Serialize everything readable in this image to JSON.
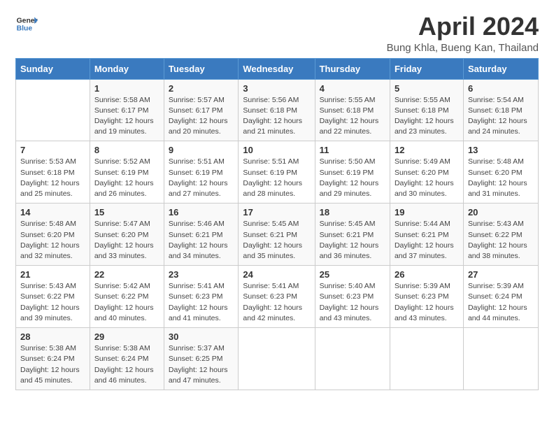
{
  "logo": {
    "line1": "General",
    "line2": "Blue"
  },
  "title": "April 2024",
  "subtitle": "Bung Khla, Bueng Kan, Thailand",
  "weekdays": [
    "Sunday",
    "Monday",
    "Tuesday",
    "Wednesday",
    "Thursday",
    "Friday",
    "Saturday"
  ],
  "weeks": [
    [
      {
        "day": "",
        "sunrise": "",
        "sunset": "",
        "daylight": ""
      },
      {
        "day": "1",
        "sunrise": "Sunrise: 5:58 AM",
        "sunset": "Sunset: 6:17 PM",
        "daylight": "Daylight: 12 hours and 19 minutes."
      },
      {
        "day": "2",
        "sunrise": "Sunrise: 5:57 AM",
        "sunset": "Sunset: 6:17 PM",
        "daylight": "Daylight: 12 hours and 20 minutes."
      },
      {
        "day": "3",
        "sunrise": "Sunrise: 5:56 AM",
        "sunset": "Sunset: 6:18 PM",
        "daylight": "Daylight: 12 hours and 21 minutes."
      },
      {
        "day": "4",
        "sunrise": "Sunrise: 5:55 AM",
        "sunset": "Sunset: 6:18 PM",
        "daylight": "Daylight: 12 hours and 22 minutes."
      },
      {
        "day": "5",
        "sunrise": "Sunrise: 5:55 AM",
        "sunset": "Sunset: 6:18 PM",
        "daylight": "Daylight: 12 hours and 23 minutes."
      },
      {
        "day": "6",
        "sunrise": "Sunrise: 5:54 AM",
        "sunset": "Sunset: 6:18 PM",
        "daylight": "Daylight: 12 hours and 24 minutes."
      }
    ],
    [
      {
        "day": "7",
        "sunrise": "Sunrise: 5:53 AM",
        "sunset": "Sunset: 6:18 PM",
        "daylight": "Daylight: 12 hours and 25 minutes."
      },
      {
        "day": "8",
        "sunrise": "Sunrise: 5:52 AM",
        "sunset": "Sunset: 6:19 PM",
        "daylight": "Daylight: 12 hours and 26 minutes."
      },
      {
        "day": "9",
        "sunrise": "Sunrise: 5:51 AM",
        "sunset": "Sunset: 6:19 PM",
        "daylight": "Daylight: 12 hours and 27 minutes."
      },
      {
        "day": "10",
        "sunrise": "Sunrise: 5:51 AM",
        "sunset": "Sunset: 6:19 PM",
        "daylight": "Daylight: 12 hours and 28 minutes."
      },
      {
        "day": "11",
        "sunrise": "Sunrise: 5:50 AM",
        "sunset": "Sunset: 6:19 PM",
        "daylight": "Daylight: 12 hours and 29 minutes."
      },
      {
        "day": "12",
        "sunrise": "Sunrise: 5:49 AM",
        "sunset": "Sunset: 6:20 PM",
        "daylight": "Daylight: 12 hours and 30 minutes."
      },
      {
        "day": "13",
        "sunrise": "Sunrise: 5:48 AM",
        "sunset": "Sunset: 6:20 PM",
        "daylight": "Daylight: 12 hours and 31 minutes."
      }
    ],
    [
      {
        "day": "14",
        "sunrise": "Sunrise: 5:48 AM",
        "sunset": "Sunset: 6:20 PM",
        "daylight": "Daylight: 12 hours and 32 minutes."
      },
      {
        "day": "15",
        "sunrise": "Sunrise: 5:47 AM",
        "sunset": "Sunset: 6:20 PM",
        "daylight": "Daylight: 12 hours and 33 minutes."
      },
      {
        "day": "16",
        "sunrise": "Sunrise: 5:46 AM",
        "sunset": "Sunset: 6:21 PM",
        "daylight": "Daylight: 12 hours and 34 minutes."
      },
      {
        "day": "17",
        "sunrise": "Sunrise: 5:45 AM",
        "sunset": "Sunset: 6:21 PM",
        "daylight": "Daylight: 12 hours and 35 minutes."
      },
      {
        "day": "18",
        "sunrise": "Sunrise: 5:45 AM",
        "sunset": "Sunset: 6:21 PM",
        "daylight": "Daylight: 12 hours and 36 minutes."
      },
      {
        "day": "19",
        "sunrise": "Sunrise: 5:44 AM",
        "sunset": "Sunset: 6:21 PM",
        "daylight": "Daylight: 12 hours and 37 minutes."
      },
      {
        "day": "20",
        "sunrise": "Sunrise: 5:43 AM",
        "sunset": "Sunset: 6:22 PM",
        "daylight": "Daylight: 12 hours and 38 minutes."
      }
    ],
    [
      {
        "day": "21",
        "sunrise": "Sunrise: 5:43 AM",
        "sunset": "Sunset: 6:22 PM",
        "daylight": "Daylight: 12 hours and 39 minutes."
      },
      {
        "day": "22",
        "sunrise": "Sunrise: 5:42 AM",
        "sunset": "Sunset: 6:22 PM",
        "daylight": "Daylight: 12 hours and 40 minutes."
      },
      {
        "day": "23",
        "sunrise": "Sunrise: 5:41 AM",
        "sunset": "Sunset: 6:23 PM",
        "daylight": "Daylight: 12 hours and 41 minutes."
      },
      {
        "day": "24",
        "sunrise": "Sunrise: 5:41 AM",
        "sunset": "Sunset: 6:23 PM",
        "daylight": "Daylight: 12 hours and 42 minutes."
      },
      {
        "day": "25",
        "sunrise": "Sunrise: 5:40 AM",
        "sunset": "Sunset: 6:23 PM",
        "daylight": "Daylight: 12 hours and 43 minutes."
      },
      {
        "day": "26",
        "sunrise": "Sunrise: 5:39 AM",
        "sunset": "Sunset: 6:23 PM",
        "daylight": "Daylight: 12 hours and 43 minutes."
      },
      {
        "day": "27",
        "sunrise": "Sunrise: 5:39 AM",
        "sunset": "Sunset: 6:24 PM",
        "daylight": "Daylight: 12 hours and 44 minutes."
      }
    ],
    [
      {
        "day": "28",
        "sunrise": "Sunrise: 5:38 AM",
        "sunset": "Sunset: 6:24 PM",
        "daylight": "Daylight: 12 hours and 45 minutes."
      },
      {
        "day": "29",
        "sunrise": "Sunrise: 5:38 AM",
        "sunset": "Sunset: 6:24 PM",
        "daylight": "Daylight: 12 hours and 46 minutes."
      },
      {
        "day": "30",
        "sunrise": "Sunrise: 5:37 AM",
        "sunset": "Sunset: 6:25 PM",
        "daylight": "Daylight: 12 hours and 47 minutes."
      },
      {
        "day": "",
        "sunrise": "",
        "sunset": "",
        "daylight": ""
      },
      {
        "day": "",
        "sunrise": "",
        "sunset": "",
        "daylight": ""
      },
      {
        "day": "",
        "sunrise": "",
        "sunset": "",
        "daylight": ""
      },
      {
        "day": "",
        "sunrise": "",
        "sunset": "",
        "daylight": ""
      }
    ]
  ]
}
